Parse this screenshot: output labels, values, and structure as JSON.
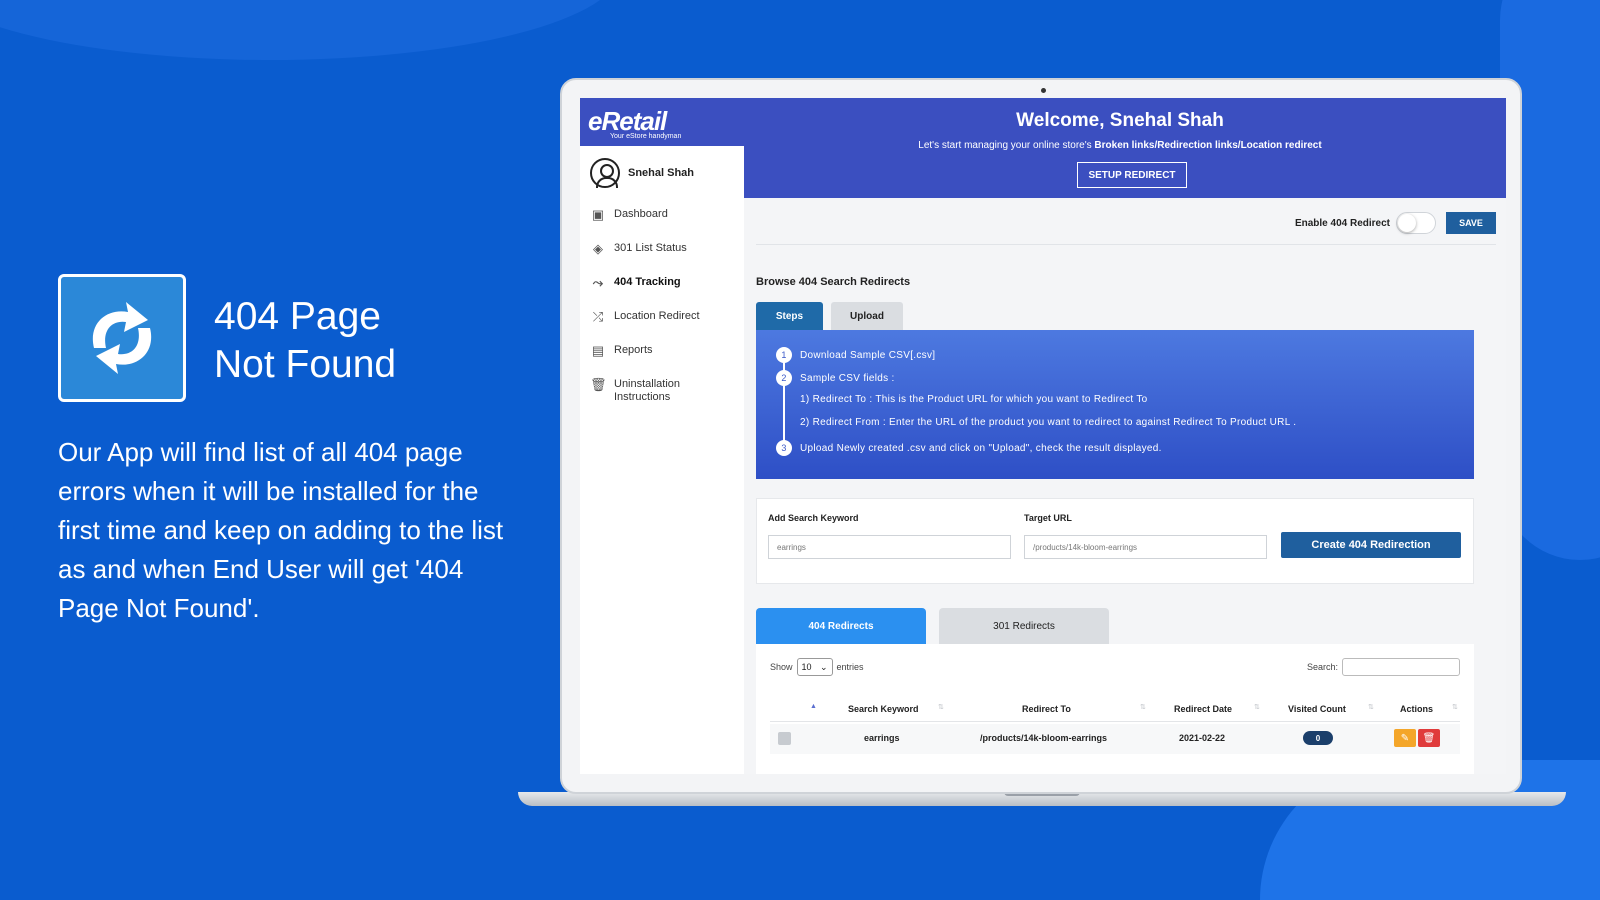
{
  "promo": {
    "icon": "refresh-arrows-icon",
    "title": "404 Page\nNot Found",
    "description": "Our App will find list of all 404 page errors when it will be installed for the first time and keep on adding to the list as and when End User will get '404 Page Not Found'."
  },
  "app": {
    "logo": "eRetail",
    "logo_tagline": "Your eStore handyman",
    "welcome": "Welcome, Snehal Shah",
    "subtitle_prefix": "Let's start managing your online store's ",
    "subtitle_bold": "Broken links/Redirection links/Location redirect",
    "setup_button": "SETUP REDIRECT"
  },
  "sidebar": {
    "user_name": "Snehal Shah",
    "items": [
      {
        "label": "Dashboard",
        "icon": "dashboard-icon"
      },
      {
        "label": "301 List Status",
        "icon": "diamond-arrows-icon"
      },
      {
        "label": "404 Tracking",
        "icon": "route-icon"
      },
      {
        "label": "Location Redirect",
        "icon": "shuffle-icon"
      },
      {
        "label": "Reports",
        "icon": "report-icon"
      },
      {
        "label": "Uninstallation Instructions",
        "icon": "trash-icon"
      }
    ],
    "active": "404 Tracking"
  },
  "settings": {
    "enable_label": "Enable 404 Redirect",
    "enabled": false,
    "save_button": "SAVE"
  },
  "browse": {
    "title": "Browse 404 Search Redirects",
    "tabs": [
      "Steps",
      "Upload"
    ],
    "active_tab": "Steps",
    "steps": [
      {
        "num": "1",
        "text": "Download Sample CSV[.csv]"
      },
      {
        "num": "2",
        "text": "Sample CSV fields :"
      },
      {
        "num": "",
        "text": "1) Redirect To : This is the Product URL for which you want to Redirect To"
      },
      {
        "num": "",
        "text": "2) Redirect From : Enter the URL of the product you want to redirect to against Redirect To Product URL ."
      },
      {
        "num": "3",
        "text": "Upload Newly created .csv and click on \"Upload\", check the result displayed."
      }
    ]
  },
  "form": {
    "keyword_label": "Add Search Keyword",
    "keyword_placeholder": "earrings",
    "target_label": "Target URL",
    "target_placeholder": "/products/14k-bloom-earrings",
    "create_button": "Create 404 Redirection"
  },
  "redirects": {
    "tabs": [
      "404 Redirects",
      "301 Redirects"
    ],
    "active_tab": "404 Redirects",
    "show_label": "Show",
    "entries_value": "10",
    "entries_label": "entries",
    "search_label": "Search:",
    "columns": [
      "Search Keyword",
      "Redirect To",
      "Redirect Date",
      "Visited Count",
      "Actions"
    ],
    "rows": [
      {
        "keyword": "earrings",
        "redirect_to": "/products/14k-bloom-earrings",
        "date": "2021-02-22",
        "visited": "0"
      }
    ]
  },
  "colors": {
    "background": "#0a5ccf",
    "header": "#3b4fc0",
    "primary_button": "#1f5f9e",
    "active_tab": "#2b90f0",
    "edit": "#f4a62a",
    "delete": "#e03b3b"
  }
}
